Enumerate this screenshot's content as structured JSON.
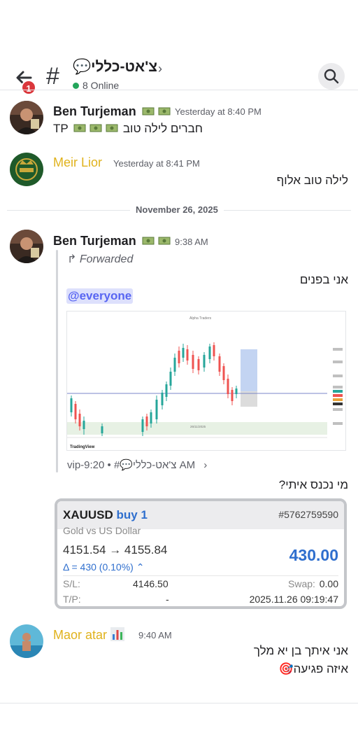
{
  "header": {
    "channel_name": "צ'אט-כללי💬",
    "online_count": "8 Online",
    "notification_count": "1"
  },
  "messages": [
    {
      "author": "Ben Turjeman",
      "timestamp": "Yesterday at 8:40 PM",
      "text": "חברים לילה טוב",
      "text_prefix": "TP"
    },
    {
      "author": "Meir Lior",
      "timestamp": "Yesterday at 8:41 PM",
      "text": "לילה טוב אלוף"
    }
  ],
  "date_separator": "November 26, 2025",
  "forward_message": {
    "author": "Ben Turjeman",
    "timestamp": "9:38 AM",
    "forwarded_label": "Forwarded",
    "text": "אני בפנים",
    "mention": "@everyone",
    "chart": {
      "title": "Alpha Traders",
      "source_label": "TradingView",
      "date_label": "26/11/2025"
    },
    "source": "vip-צ'אט-כללי💬# • 9:20 AM",
    "followup": "מי נכנס איתי?"
  },
  "trade": {
    "symbol": "XAUUSD",
    "side": "buy 1",
    "id": "#5762759590",
    "description": "Gold vs US Dollar",
    "price_from": "4151.54",
    "price_to": "4155.84",
    "arrow": "→",
    "profit": "430.00",
    "delta": "Δ = 430 (0.10%)",
    "sl_label": "S/L:",
    "sl_value": "4146.50",
    "tp_label": "T/P:",
    "tp_value": "-",
    "swap_label": "Swap:",
    "swap_value": "0.00",
    "time": "2025.11.26 09:19:47"
  },
  "last_message": {
    "author": "Maor atar",
    "timestamp": "9:40 AM",
    "line1": "אני איתך בן יא מלך",
    "line2": "איזה פגיעה🎯"
  },
  "colors": {
    "gold_name": "#e0b21c",
    "mention_text": "#5865f2",
    "mention_bg": "#dde0fc",
    "profit_blue": "#2f6fce",
    "online_green": "#23a55a",
    "badge_red": "#da373c"
  }
}
